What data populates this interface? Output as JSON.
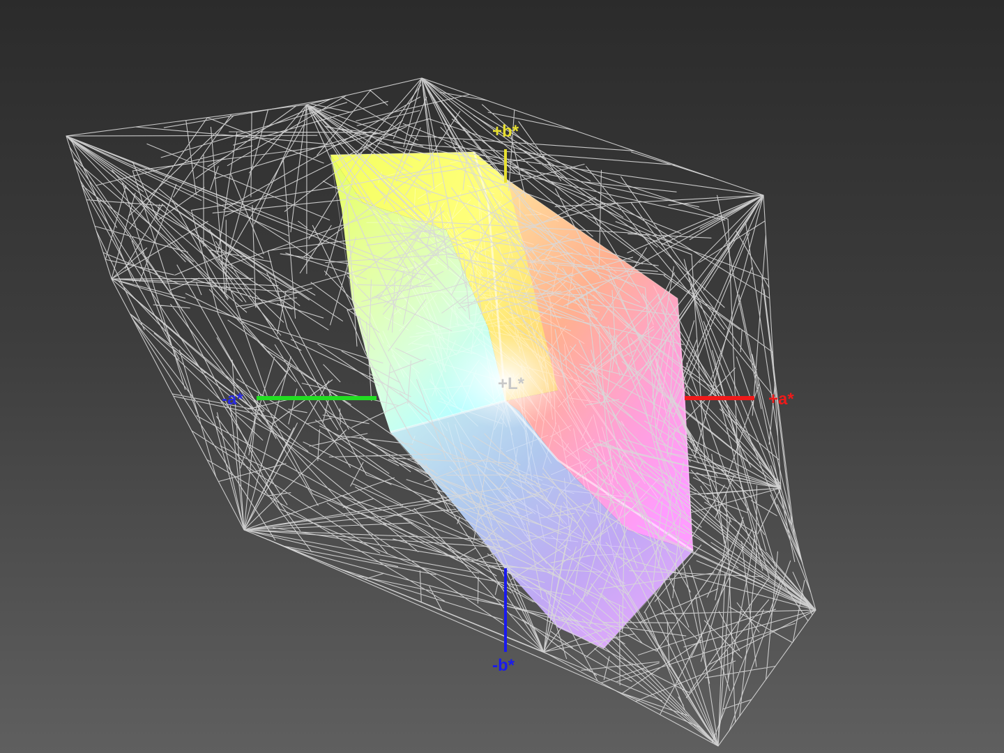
{
  "axes": {
    "plus_b": {
      "label": "+b*",
      "color": "#e8e030"
    },
    "minus_b": {
      "label": "-b*",
      "color": "#1a1aee"
    },
    "plus_a": {
      "label": "+a*",
      "color": "#ee1a1a"
    },
    "minus_a": {
      "label": "-a*",
      "color": "#2a2ae0",
      "line_color": "#22dd22"
    },
    "plus_L": {
      "label": "+L*",
      "color": "#c8c8c8"
    }
  },
  "colors": {
    "background_top": "#2b2b2b",
    "background_bottom": "#5f5f5f",
    "wireframe": "#d8d8d8"
  }
}
